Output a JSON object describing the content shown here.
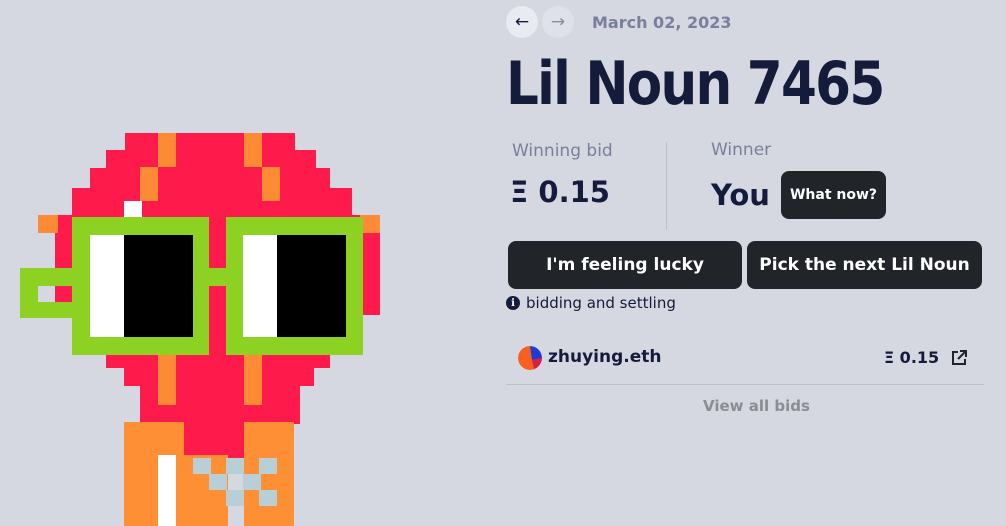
{
  "noun": {
    "nav": {
      "prev_icon": "←",
      "next_icon": "→"
    },
    "date": "March 02, 2023",
    "title": "Lil Noun 7465"
  },
  "auction": {
    "winning_bid_label": "Winning bid",
    "winning_bid_value": "Ξ 0.15",
    "winner_label": "Winner",
    "winner_value": "You",
    "what_now_label": "What now?"
  },
  "actions": {
    "lucky_label": "I'm feeling lucky",
    "next_label": "Pick the next Lil Noun"
  },
  "info": {
    "icon": "i",
    "text": "bidding and settling"
  },
  "bids": [
    {
      "bidder": "zhuying.eth",
      "amount": "Ξ 0.15"
    }
  ],
  "view_all_label": "View all bids",
  "colors": {
    "background": "#d5d7e1",
    "text_primary": "#151c3b",
    "text_muted": "#79809c",
    "button_dark": "#212529",
    "head_red": "#fe1b4c",
    "head_orange": "#fd8b36",
    "glasses_green": "#8dd122",
    "body_orange": "#fe8f34",
    "accessory_grey": "#b8cfd5"
  }
}
